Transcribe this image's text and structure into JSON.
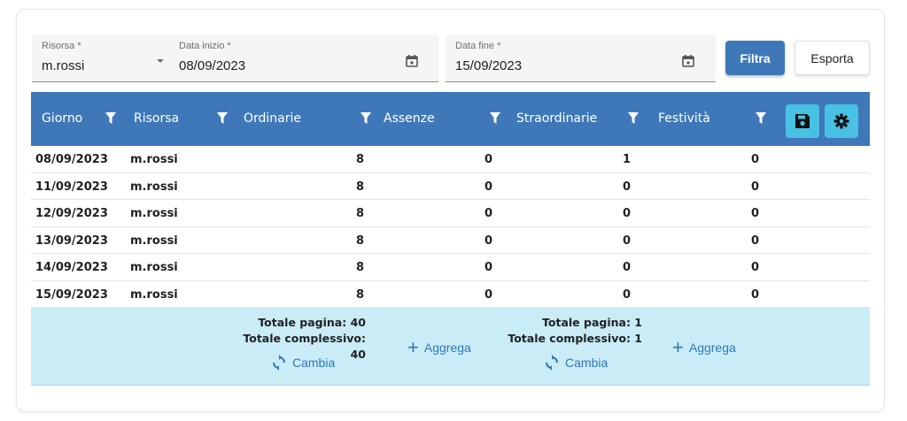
{
  "filters": {
    "risorsa": {
      "label": "Risorsa *",
      "value": "m.rossi"
    },
    "data_inizio": {
      "label": "Data inizio *",
      "value": "08/09/2023"
    },
    "data_fine": {
      "label": "Data fine *",
      "value": "15/09/2023"
    },
    "filtra_label": "Filtra",
    "esporta_label": "Esporta"
  },
  "columns": [
    "Giorno",
    "Risorsa",
    "Ordinarie",
    "Assenze",
    "Straordinarie",
    "Festività"
  ],
  "rows": [
    [
      "08/09/2023",
      "m.rossi",
      "8",
      "0",
      "1",
      "0"
    ],
    [
      "11/09/2023",
      "m.rossi",
      "8",
      "0",
      "0",
      "0"
    ],
    [
      "12/09/2023",
      "m.rossi",
      "8",
      "0",
      "0",
      "0"
    ],
    [
      "13/09/2023",
      "m.rossi",
      "8",
      "0",
      "0",
      "0"
    ],
    [
      "14/09/2023",
      "m.rossi",
      "8",
      "0",
      "0",
      "0"
    ],
    [
      "15/09/2023",
      "m.rossi",
      "8",
      "0",
      "0",
      "0"
    ]
  ],
  "summary": {
    "ordinarie": {
      "page": "Totale pagina: 40",
      "total": "Totale complessivo: 40",
      "cambia": "Cambia"
    },
    "straordinarie": {
      "page": "Totale pagina: 1",
      "total": "Totale complessivo: 1",
      "cambia": "Cambia"
    },
    "aggrega_label": "Aggrega"
  },
  "colors": {
    "header": "#3f78b9",
    "tool_button": "#48c1e5",
    "footer": "#c9ecf6",
    "link": "#2f78b8"
  },
  "icons": [
    "chevron-down-icon",
    "calendar-icon",
    "filter-icon",
    "save-icon",
    "gear-icon",
    "refresh-icon",
    "plus-icon"
  ]
}
